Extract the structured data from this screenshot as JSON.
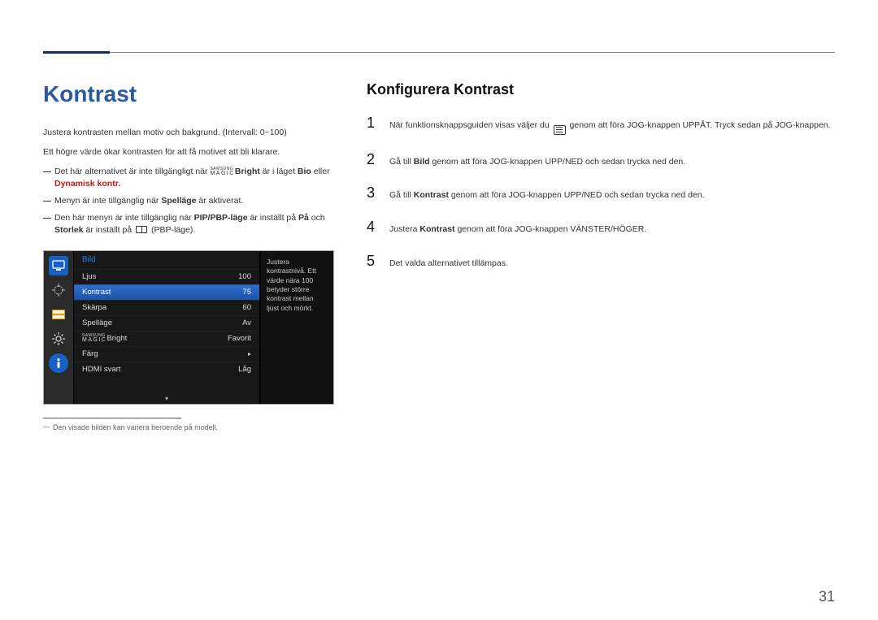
{
  "header": {
    "title": "Kontrast"
  },
  "left": {
    "para1": "Justera kontrasten mellan motiv och bakgrund. (Intervall: 0~100)",
    "para2": "Ett högre värde ökar kontrasten för att få motivet att bli klarare.",
    "note1_pre": "Det här alternativet är inte tillgängligt när ",
    "note1_brand_top": "SAMSUNG",
    "note1_brand_bot": "MAGIC",
    "note1_mid": "Bright",
    "note1_post": " är i läget ",
    "note1_bio": "Bio",
    "note1_eller": " eller ",
    "note1_dyn": "Dynamisk kontr.",
    "note2_pre": "Menyn är inte tillgänglig när ",
    "note2_bold": "Spelläge",
    "note2_post": " är aktiverat.",
    "note3_pre": "Den här menyn är inte tillgänglig när ",
    "note3_b1": "PIP/PBP-läge",
    "note3_mid1": " är inställt på ",
    "note3_b2": "På",
    "note3_mid2": " och ",
    "note3_b3": "Storlek",
    "note3_post1": " är inställt på ",
    "note3_post2": " (PBP-läge).",
    "footnote": "Den visade bilden kan variera beroende på modell."
  },
  "osd": {
    "header": "Bild",
    "rows": [
      {
        "label": "Ljus",
        "value": "100"
      },
      {
        "label": "Kontrast",
        "value": "75"
      },
      {
        "label": "Skärpa",
        "value": "60"
      },
      {
        "label": "Spelläge",
        "value": "Av"
      },
      {
        "label_brand_top": "SAMSUNG",
        "label_brand_bot": "MAGIC",
        "label_suffix": "Bright",
        "value": "Favorit"
      },
      {
        "label": "Färg",
        "value": "▸"
      },
      {
        "label": "HDMI svart",
        "value": "Låg"
      }
    ],
    "help": "Justera kontrastnivå. Ett värde nära 100 betyder större kontrast mellan ljust och mörkt."
  },
  "right": {
    "title": "Konfigurera Kontrast",
    "steps": {
      "s1_pre": "När funktionsknappsguiden visas väljer du ",
      "s1_post": " genom att föra JOG-knappen UPPÅT. Tryck sedan på JOG-knappen.",
      "s2_pre": "Gå till ",
      "s2_bold": "Bild",
      "s2_post": " genom att föra JOG-knappen UPP/NED och sedan trycka ned den.",
      "s3_pre": "Gå till ",
      "s3_bold": "Kontrast",
      "s3_post": " genom att föra JOG-knappen UPP/NED och sedan trycka ned den.",
      "s4_pre": "Justera ",
      "s4_bold": "Kontrast",
      "s4_post": " genom att föra JOG-knappen VÄNSTER/HÖGER.",
      "s5": "Det valda alternativet tillämpas."
    },
    "nums": {
      "n1": "1",
      "n2": "2",
      "n3": "3",
      "n4": "4",
      "n5": "5"
    }
  },
  "pagenum": "31"
}
